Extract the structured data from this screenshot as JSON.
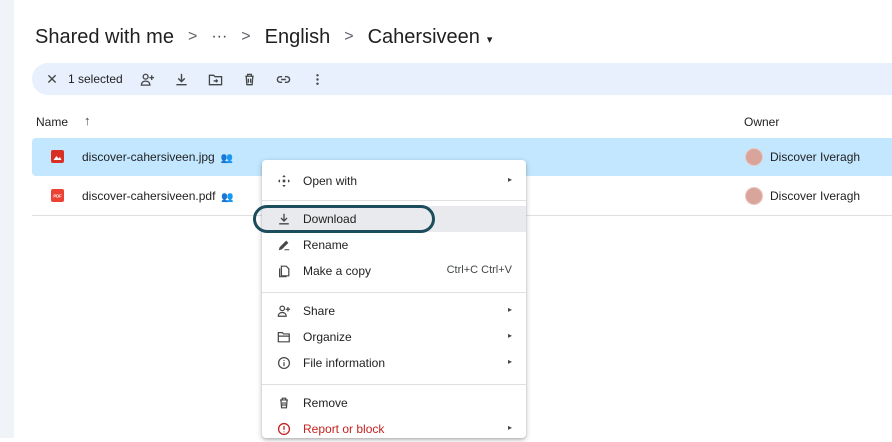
{
  "breadcrumb": {
    "root": "Shared with me",
    "ellipsis": "···",
    "folder": "English",
    "current": "Cahersiveen",
    "separator": ">",
    "dropdown_caret": "▾"
  },
  "selection_bar": {
    "close": "✕",
    "count_label": "1 selected",
    "icons": [
      "share-person-add-icon",
      "download-icon",
      "move-to-folder-icon",
      "trash-icon",
      "link-icon",
      "more-vert-icon"
    ]
  },
  "list_header": {
    "name": "Name",
    "sort_arrow": "↑",
    "owner": "Owner"
  },
  "files": [
    {
      "name": "discover-cahersiveen.jpg",
      "type": "image",
      "owner": "Discover Iveragh",
      "selected": true,
      "icon_color": "#d93025"
    },
    {
      "name": "discover-cahersiveen.pdf",
      "type": "pdf",
      "owner": "Discover Iveragh",
      "selected": false,
      "icon_color": "#ea4335"
    }
  ],
  "context_menu": {
    "open_with": "Open with",
    "download": "Download",
    "rename": "Rename",
    "make_copy": "Make a copy",
    "make_copy_shortcut": "Ctrl+C Ctrl+V",
    "share": "Share",
    "organize": "Organize",
    "file_information": "File information",
    "remove": "Remove",
    "report_or_block": "Report or block",
    "submenu_arrow": "▸",
    "highlighted": "Download"
  },
  "colors": {
    "selected_row": "#c2e7ff",
    "selection_bar": "#e8f0fe",
    "highlight_ring": "#1b4d5c",
    "danger": "#c5221f"
  }
}
